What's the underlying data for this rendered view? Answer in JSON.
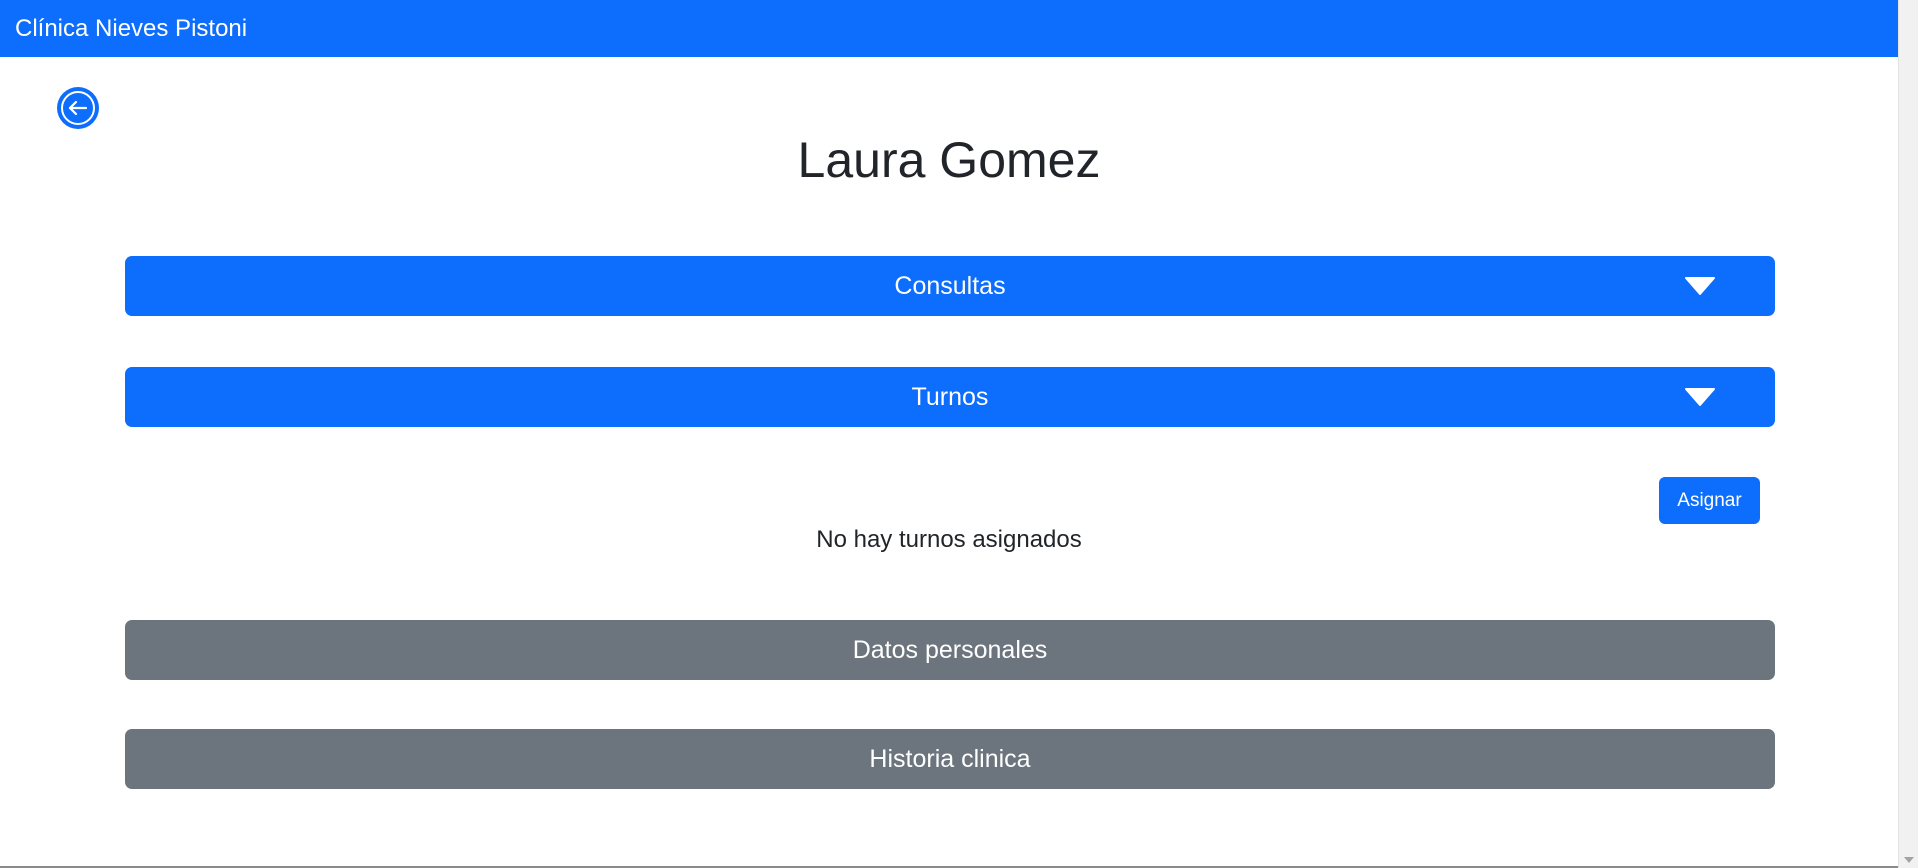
{
  "navbar": {
    "brand": "Clínica Nieves Pistoni"
  },
  "back_button": {
    "icon": "arrow-left-circle-icon"
  },
  "page": {
    "title": "Laura Gomez"
  },
  "sections": {
    "consultas": {
      "label": "Consultas",
      "icon": "caret-down-icon"
    },
    "turnos": {
      "label": "Turnos",
      "icon": "caret-down-icon"
    },
    "datos_personales": {
      "label": "Datos personales"
    },
    "historia_clinica": {
      "label": "Historia clinica"
    }
  },
  "turnos_panel": {
    "assign_label": "Asignar",
    "empty_message": "No hay turnos asignados"
  },
  "colors": {
    "primary": "#0d6efd",
    "secondary": "#6c757d",
    "text": "#212529"
  }
}
